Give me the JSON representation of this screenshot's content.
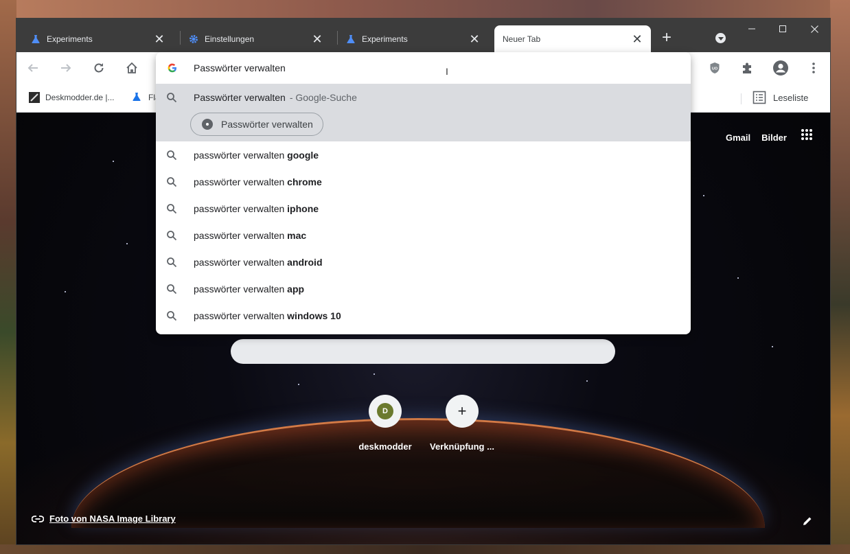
{
  "tabs": [
    {
      "label": "Experiments",
      "icon": "flask-icon"
    },
    {
      "label": "Einstellungen",
      "icon": "gear-icon"
    },
    {
      "label": "Experiments",
      "icon": "flask-icon"
    },
    {
      "label": "Neuer Tab",
      "icon": ""
    }
  ],
  "toolbar": {
    "omnibox_text": "Passwörter verwalten"
  },
  "bookmarks": [
    {
      "label": "Deskmodder.de |...",
      "icon": "deskmodder-icon"
    },
    {
      "label": "Fla",
      "icon": "flask-icon"
    }
  ],
  "reading_list": {
    "label": "Leseliste"
  },
  "omnibox": {
    "selected": {
      "query": "Passwörter verwalten",
      "meta": "- Google-Suche",
      "pedal_label": "Passwörter verwalten"
    },
    "suggestions": [
      {
        "prefix": "passwörter verwalten ",
        "bold": "google"
      },
      {
        "prefix": "passwörter verwalten ",
        "bold": "chrome"
      },
      {
        "prefix": "passwörter verwalten ",
        "bold": "iphone"
      },
      {
        "prefix": "passwörter verwalten ",
        "bold": "mac"
      },
      {
        "prefix": "passwörter verwalten ",
        "bold": "android"
      },
      {
        "prefix": "passwörter verwalten ",
        "bold": "app"
      },
      {
        "prefix": "passwörter verwalten ",
        "bold": "windows 10"
      }
    ]
  },
  "ntp": {
    "gmail": "Gmail",
    "images": "Bilder",
    "shortcuts": [
      {
        "label": "deskmodder",
        "initial": "D"
      },
      {
        "label": "Verknüpfung ...",
        "initial": "+"
      }
    ],
    "attribution": "Foto von NASA Image Library"
  },
  "colors": {
    "tab_strip": "#3c3c3c",
    "accent_blue": "#1a73e8",
    "avatar_olive": "#6b7a2e"
  }
}
